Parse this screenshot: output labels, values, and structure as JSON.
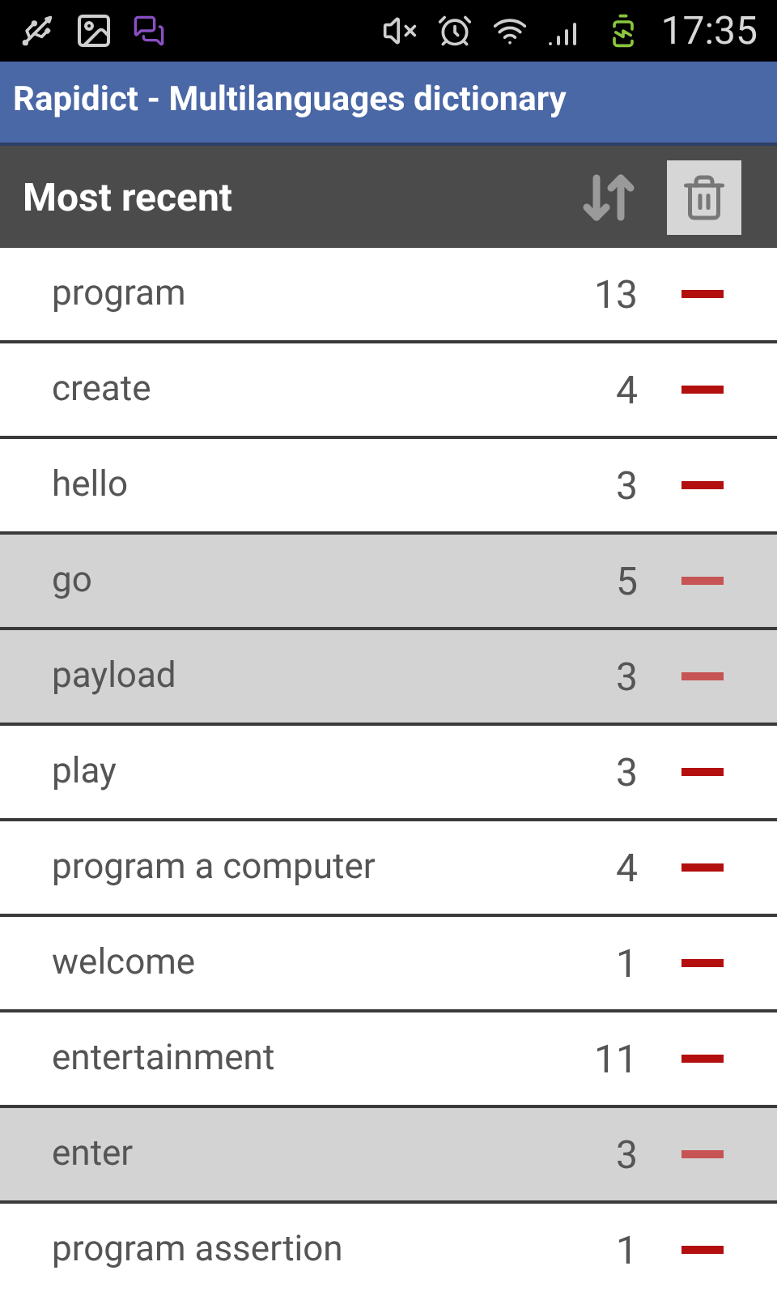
{
  "status_bar": {
    "time": "17:35"
  },
  "title_bar": {
    "title": "Rapidict - Multilanguages dictionary"
  },
  "header": {
    "title": "Most recent"
  },
  "rows": [
    {
      "word": "program",
      "count": "13",
      "highlighted": false
    },
    {
      "word": "create",
      "count": "4",
      "highlighted": false
    },
    {
      "word": "hello",
      "count": "3",
      "highlighted": false
    },
    {
      "word": "go",
      "count": "5",
      "highlighted": true
    },
    {
      "word": "payload",
      "count": "3",
      "highlighted": true
    },
    {
      "word": "play",
      "count": "3",
      "highlighted": false
    },
    {
      "word": "program a computer",
      "count": "4",
      "highlighted": false
    },
    {
      "word": "welcome",
      "count": "1",
      "highlighted": false
    },
    {
      "word": "entertainment",
      "count": "11",
      "highlighted": false
    },
    {
      "word": "enter",
      "count": "3",
      "highlighted": true
    },
    {
      "word": "program assertion",
      "count": "1",
      "highlighted": false
    }
  ]
}
